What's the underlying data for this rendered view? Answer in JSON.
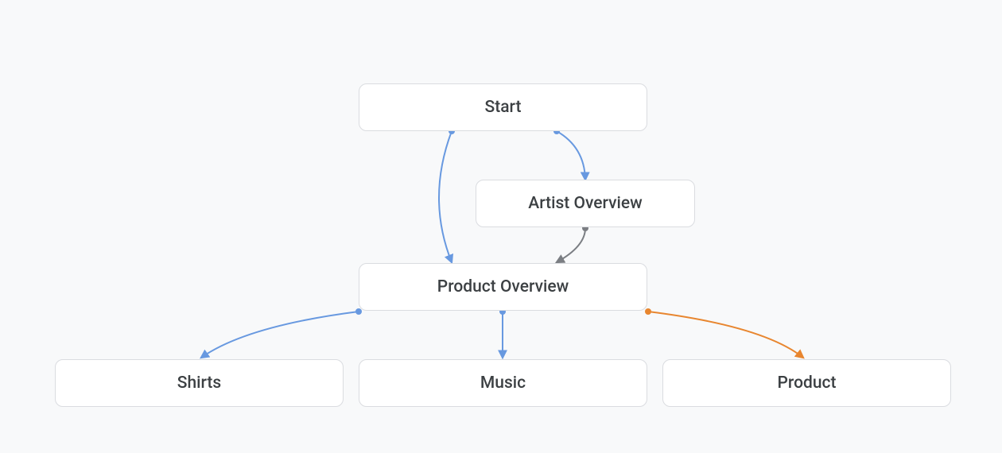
{
  "nodes": {
    "start": {
      "label": "Start"
    },
    "artist_overview": {
      "label": "Artist Overview"
    },
    "product_overview": {
      "label": "Product Overview"
    },
    "shirts": {
      "label": "Shirts"
    },
    "music": {
      "label": "Music"
    },
    "product": {
      "label": "Product"
    }
  },
  "colors": {
    "blue": "#6899e0",
    "gray": "#7b7e83",
    "orange": "#e8862f"
  }
}
